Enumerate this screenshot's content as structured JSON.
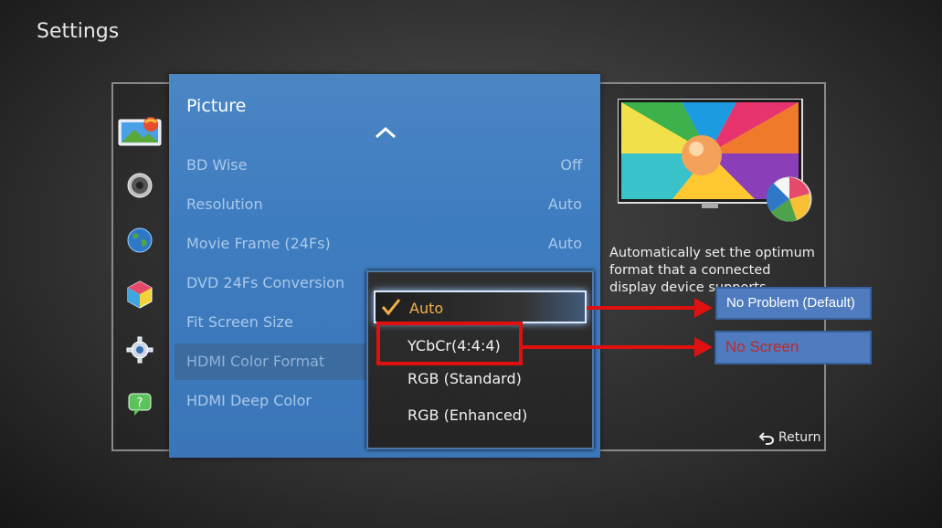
{
  "screen": {
    "title": "Settings"
  },
  "categories": [
    {
      "icon": "picture-icon"
    },
    {
      "icon": "sound-icon"
    },
    {
      "icon": "network-icon"
    },
    {
      "icon": "smart-features-icon"
    },
    {
      "icon": "system-gear-icon"
    },
    {
      "icon": "support-icon"
    }
  ],
  "menu": {
    "title": "Picture",
    "items": [
      {
        "label": "BD Wise",
        "value": "Off"
      },
      {
        "label": "Resolution",
        "value": "Auto"
      },
      {
        "label": "Movie Frame (24Fs)",
        "value": "Auto"
      },
      {
        "label": "DVD 24Fs Conversion",
        "value": ""
      },
      {
        "label": "Fit Screen Size",
        "value": ""
      },
      {
        "label": "HDMI Color Format",
        "value": ""
      },
      {
        "label": "HDMI Deep Color",
        "value": ""
      }
    ]
  },
  "popup": {
    "options": [
      {
        "label": "Auto"
      },
      {
        "label": "YCbCr(4:4:4)"
      },
      {
        "label": "RGB (Standard)"
      },
      {
        "label": "RGB (Enhanced)"
      }
    ]
  },
  "help": {
    "description": "Automatically set the optimum format that a connected display device supports."
  },
  "footer": {
    "return_label": "Return"
  },
  "annotations": {
    "callout_default": "No Problem (Default)",
    "callout_no_screen": "No Screen",
    "arrow_color": "#e01010"
  },
  "colors": {
    "menu_blue": "#3e7cc0",
    "focus_text": "#f0b14b",
    "callout_bg": "#4f7cbf",
    "no_screen_text": "#c0282b"
  }
}
